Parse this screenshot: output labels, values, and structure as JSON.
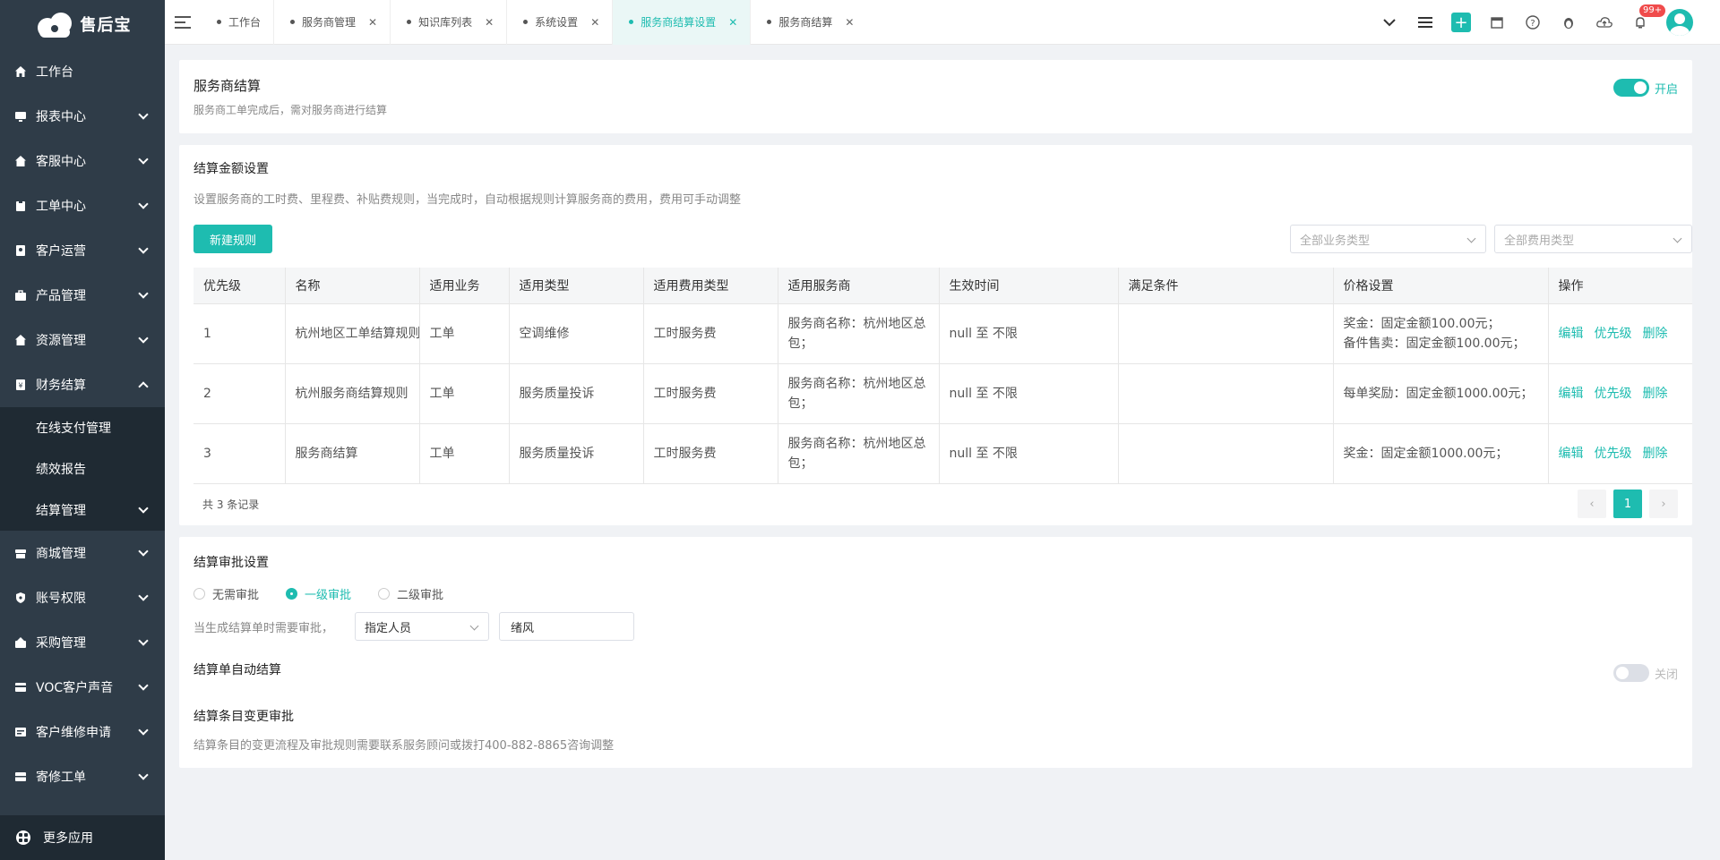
{
  "app": {
    "logo_text": "售后宝"
  },
  "sidebar": {
    "items": [
      {
        "label": "工作台",
        "icon": "home-icon"
      },
      {
        "label": "报表中心",
        "icon": "monitor-icon"
      },
      {
        "label": "客服中心",
        "icon": "home-icon"
      },
      {
        "label": "工单中心",
        "icon": "clipboard-icon"
      },
      {
        "label": "客户运营",
        "icon": "contact-icon"
      },
      {
        "label": "产品管理",
        "icon": "briefcase-icon"
      },
      {
        "label": "资源管理",
        "icon": "home-icon"
      },
      {
        "label": "财务结算",
        "icon": "finance-icon"
      }
    ],
    "finance_sub": [
      "在线支付管理",
      "绩效报告",
      "结算管理"
    ],
    "items2": [
      {
        "label": "商城管理",
        "icon": "shop-icon"
      },
      {
        "label": "账号权限",
        "icon": "shield-icon"
      },
      {
        "label": "采购管理",
        "icon": "purchase-icon"
      },
      {
        "label": "VOC客户声音",
        "icon": "card-icon"
      },
      {
        "label": "客户维修申请",
        "icon": "repair-icon"
      },
      {
        "label": "寄修工单",
        "icon": "box-icon"
      }
    ],
    "more_apps": "更多应用"
  },
  "tabs": [
    {
      "label": "工作台",
      "closable": false
    },
    {
      "label": "服务商管理",
      "closable": true
    },
    {
      "label": "知识库列表",
      "closable": true
    },
    {
      "label": "系统设置",
      "closable": true
    },
    {
      "label": "服务商结算设置",
      "closable": true,
      "active": true
    },
    {
      "label": "服务商结算",
      "closable": true
    }
  ],
  "topbar": {
    "badge": "99+"
  },
  "settle_header": {
    "title": "服务商结算",
    "subtitle": "服务商工单完成后，需对服务商进行结算",
    "switch_label": "开启"
  },
  "amount_settings": {
    "title": "结算金额设置",
    "desc": "设置服务商的工时费、里程费、补贴费规则，当完成时，自动根据规则计算服务商的费用，费用可手动调整",
    "new_rule": "新建规则",
    "filter_business": "全部业务类型",
    "filter_fee": "全部费用类型",
    "columns": [
      "优先级",
      "名称",
      "适用业务",
      "适用类型",
      "适用费用类型",
      "适用服务商",
      "生效时间",
      "满足条件",
      "价格设置",
      "操作"
    ],
    "rows": [
      {
        "priority": "1",
        "name": "杭州地区工单结算规则",
        "business": "工单",
        "type": "空调维修",
        "fee_type": "工时服务费",
        "provider": "服务商名称：杭州地区总包；",
        "time": "null 至 不限",
        "cond": "",
        "price1": "奖金：固定金额100.00元；",
        "price2": "备件售卖：固定金额100.00元；"
      },
      {
        "priority": "2",
        "name": "杭州服务商结算规则",
        "business": "工单",
        "type": "服务质量投诉",
        "fee_type": "工时服务费",
        "provider": "服务商名称：杭州地区总包；",
        "time": "null 至 不限",
        "cond": "",
        "price1": "每单奖励：固定金额1000.00元；",
        "price2": ""
      },
      {
        "priority": "3",
        "name": "服务商结算",
        "business": "工单",
        "type": "服务质量投诉",
        "fee_type": "工时服务费",
        "provider": "服务商名称：杭州地区总包；",
        "time": "null 至 不限",
        "cond": "",
        "price1": "奖金：固定金额1000.00元；",
        "price2": ""
      }
    ],
    "ops": {
      "edit": "编辑",
      "priority": "优先级",
      "delete": "删除"
    },
    "total": "共 3 条记录",
    "page": "1"
  },
  "approval": {
    "title": "结算审批设置",
    "options": [
      "无需审批",
      "一级审批",
      "二级审批"
    ],
    "selected": "一级审批",
    "prompt": "当生成结算单时需要审批，",
    "approver_type": "指定人员",
    "approver": "绪风",
    "auto_title": "结算单自动结算",
    "auto_switch": "关闭",
    "change_title": "结算条目变更审批",
    "change_desc": "结算条目的变更流程及审批规则需要联系服务顾问或拨打400-882-8865咨询调整"
  },
  "colors": {
    "accent": "#1ebcb0",
    "sidebar_bg": "#2f3c48",
    "submenu_bg": "#1f2a33"
  }
}
